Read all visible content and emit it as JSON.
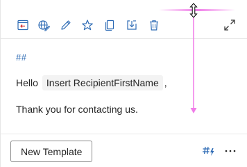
{
  "toolbar": {
    "items": [
      {
        "icon": "insert-template-icon"
      },
      {
        "icon": "edit-globe-icon"
      },
      {
        "icon": "pencil-icon"
      },
      {
        "icon": "star-icon"
      },
      {
        "icon": "copy-icon"
      },
      {
        "icon": "save-download-icon"
      },
      {
        "icon": "trash-icon"
      }
    ],
    "expand_icon": "expand-icon"
  },
  "content": {
    "heading_marker": "##",
    "greeting": "Hello",
    "token_label": "Insert RecipientFirstName",
    "token_suffix": ",",
    "body_line": "Thank you for contacting us."
  },
  "footer": {
    "new_template_label": "New Template",
    "hashtag_icon": "hashtag-lightning-icon",
    "more_icon": "more-options-icon"
  },
  "colors": {
    "accent": "#2f6cb5",
    "border": "#e8e8e8",
    "token_bg": "#f3f3f3",
    "resize_guide": "#f07ce8"
  }
}
